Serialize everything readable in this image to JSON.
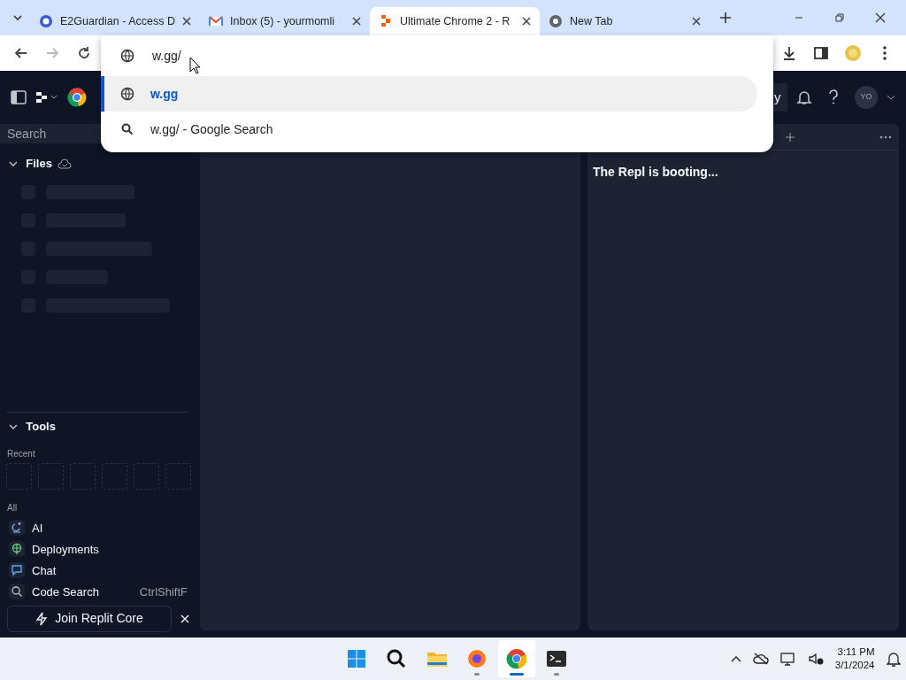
{
  "browser_tabs": [
    {
      "title": "E2Guardian - Access D",
      "kind": "guardian",
      "selected": false
    },
    {
      "title": "Inbox (5) - yourmomli",
      "kind": "mail",
      "selected": false
    },
    {
      "title": "Ultimate Chrome 2 - R",
      "kind": "replit",
      "selected": true
    },
    {
      "title": "New Tab",
      "kind": "chrome",
      "selected": false
    }
  ],
  "omnibox": {
    "value": "w.gg/",
    "suggestions": [
      {
        "text": "w.gg",
        "kind": "url",
        "selected": true
      },
      {
        "text": "w.gg/ - Google Search",
        "kind": "search",
        "selected": false
      }
    ]
  },
  "replit_header": {
    "partial_button": "y",
    "avatar": "YO"
  },
  "sidebar": {
    "search": {
      "placeholder": "Search"
    },
    "files_title": "Files",
    "tools_title": "Tools",
    "recent_label": "Recent",
    "all_label": "All",
    "tools": [
      {
        "label": "AI",
        "kind": "ai"
      },
      {
        "label": "Deployments",
        "kind": "deploy"
      },
      {
        "label": "Chat",
        "kind": "chat"
      },
      {
        "label": "Code Search",
        "kind": "search",
        "shortcut": "CtrlShiftF"
      }
    ],
    "join_button": "Join Replit Core"
  },
  "console": {
    "message": "The Repl is booting..."
  },
  "taskbar": {
    "apps": [
      {
        "kind": "start",
        "running": false,
        "selected": false
      },
      {
        "kind": "search",
        "running": false,
        "selected": false
      },
      {
        "kind": "folder",
        "running": false,
        "selected": false
      },
      {
        "kind": "firefox",
        "running": true,
        "selected": false
      },
      {
        "kind": "chrome",
        "running": true,
        "selected": true
      },
      {
        "kind": "terminal",
        "running": true,
        "selected": false
      }
    ],
    "time": "3:11 PM",
    "date": "3/1/2024"
  }
}
